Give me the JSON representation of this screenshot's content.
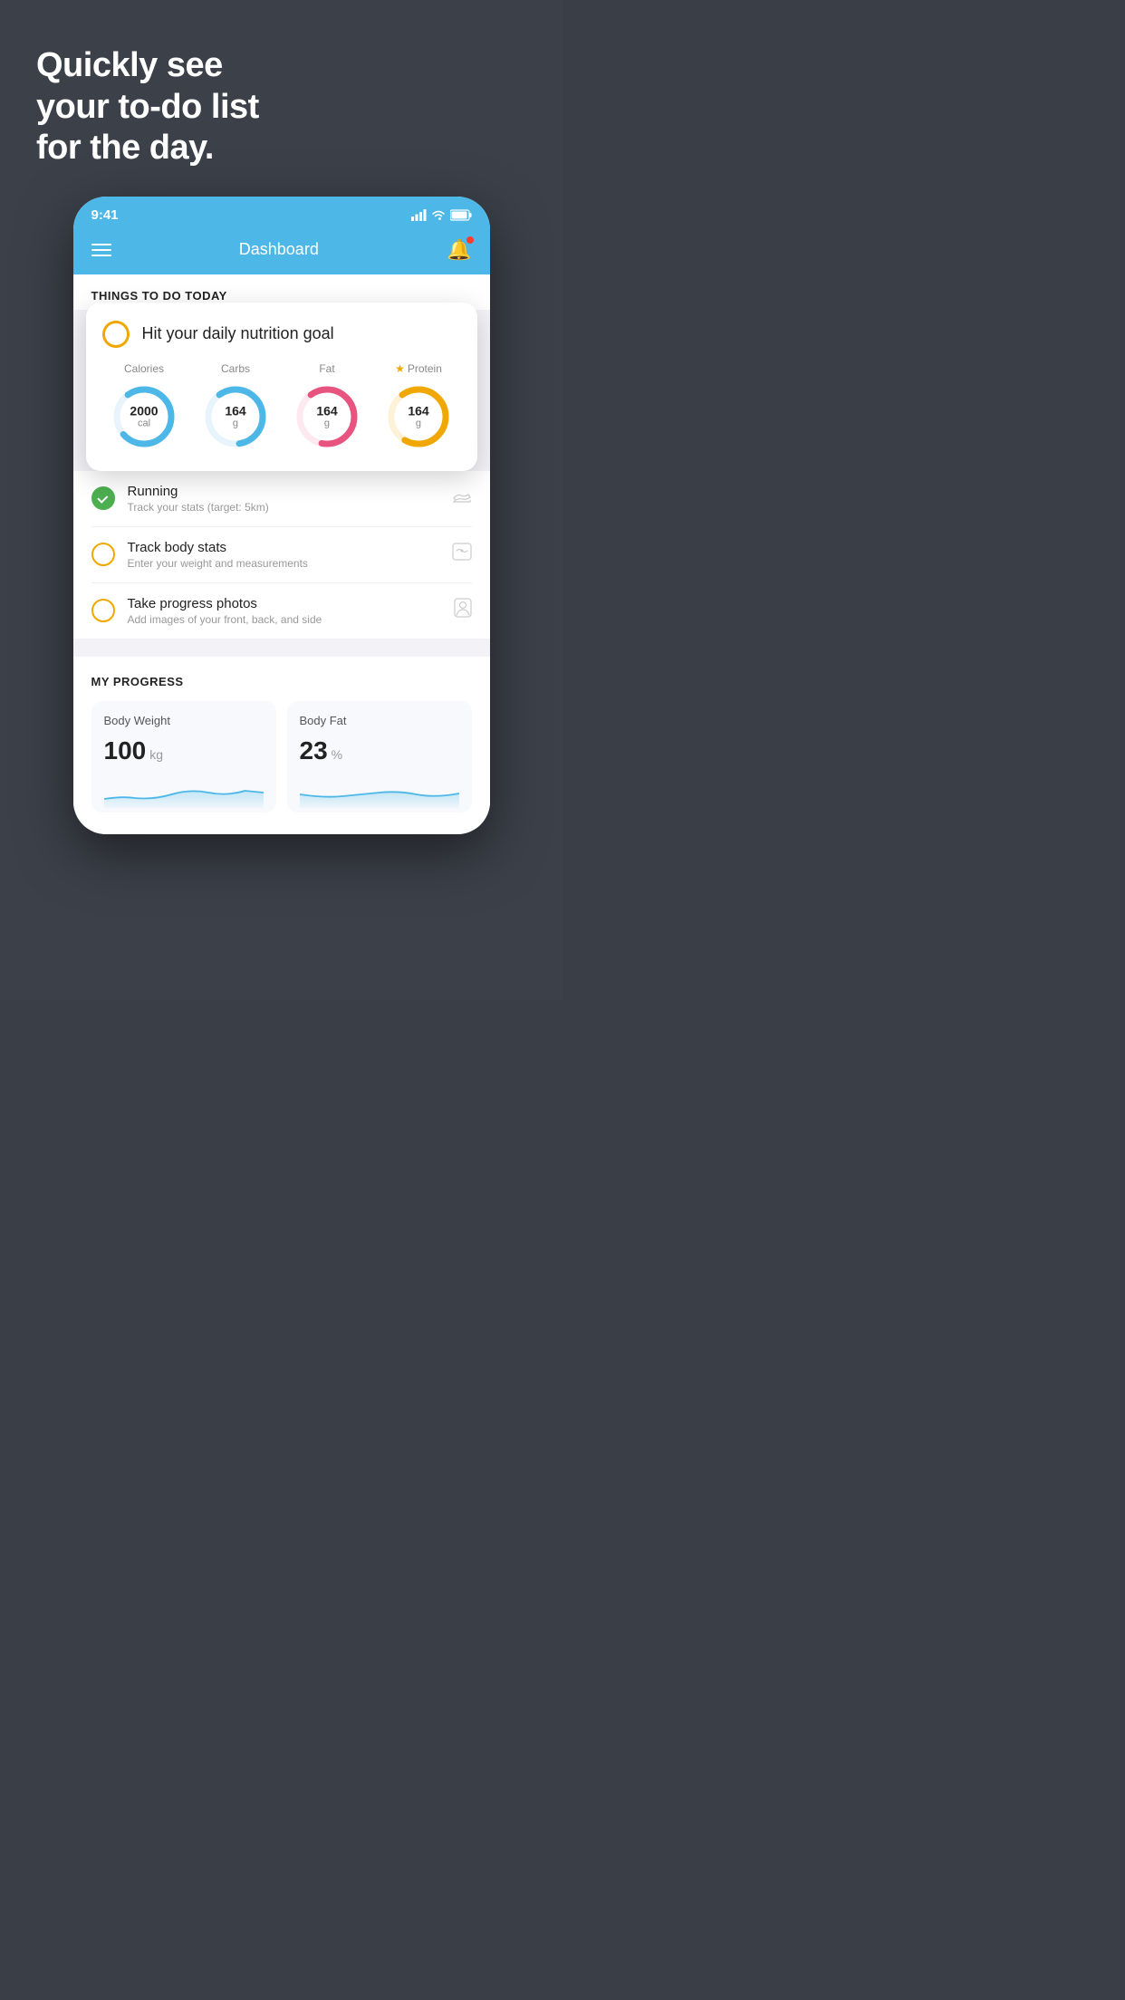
{
  "hero": {
    "line1": "Quickly see",
    "line2": "your to-do list",
    "line3": "for the day."
  },
  "status_bar": {
    "time": "9:41",
    "signal_icon": "signal",
    "wifi_icon": "wifi",
    "battery_icon": "battery"
  },
  "nav": {
    "title": "Dashboard",
    "menu_icon": "hamburger",
    "bell_icon": "bell"
  },
  "section_today": {
    "heading": "THINGS TO DO TODAY"
  },
  "nutrition_card": {
    "circle_indicator": "incomplete",
    "goal_label": "Hit your daily nutrition goal",
    "stats": [
      {
        "label": "Calories",
        "value": "2000",
        "unit": "cal",
        "color": "#4db8e8",
        "starred": false
      },
      {
        "label": "Carbs",
        "value": "164",
        "unit": "g",
        "color": "#4db8e8",
        "starred": false
      },
      {
        "label": "Fat",
        "value": "164",
        "unit": "g",
        "color": "#e85480",
        "starred": false
      },
      {
        "label": "Protein",
        "value": "164",
        "unit": "g",
        "color": "#f0a800",
        "starred": true
      }
    ]
  },
  "todo_items": [
    {
      "id": "running",
      "title": "Running",
      "subtitle": "Track your stats (target: 5km)",
      "status": "complete",
      "icon": "shoe"
    },
    {
      "id": "body-stats",
      "title": "Track body stats",
      "subtitle": "Enter your weight and measurements",
      "status": "incomplete",
      "icon": "scale"
    },
    {
      "id": "photos",
      "title": "Take progress photos",
      "subtitle": "Add images of your front, back, and side",
      "status": "incomplete",
      "icon": "person-photo"
    }
  ],
  "progress_section": {
    "heading": "MY PROGRESS",
    "cards": [
      {
        "title": "Body Weight",
        "value": "100",
        "unit": "kg"
      },
      {
        "title": "Body Fat",
        "value": "23",
        "unit": "%"
      }
    ]
  }
}
